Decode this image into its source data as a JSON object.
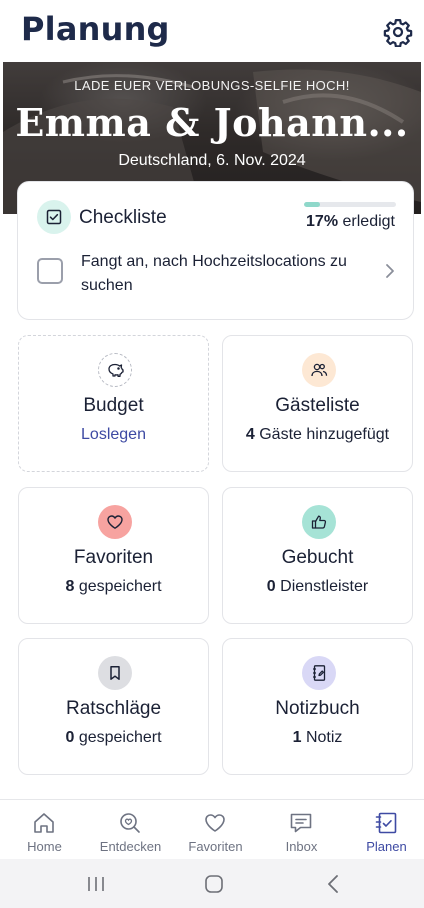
{
  "header": {
    "title": "Planung",
    "settings_icon": "gear-icon"
  },
  "hero": {
    "upload_prompt": "LADE EUER VERLOBUNGS-SELFIE HOCH!",
    "couple_names": "Emma & Johann...",
    "location_date": "Deutschland, 6. Nov. 2024"
  },
  "checklist": {
    "title": "Checkliste",
    "progress_percent": 17,
    "progress_text": "17%",
    "progress_suffix": "erledigt",
    "task": "Fangt an, nach Hochzeitslocations zu suchen"
  },
  "tiles": [
    {
      "title": "Budget",
      "count": "",
      "subtitle": "Loslegen",
      "icon": "piggy-bank-icon",
      "icon_bg": "#ffffff"
    },
    {
      "title": "Gästeliste",
      "count": "4",
      "subtitle": "Gäste hinzugefügt",
      "icon": "guests-icon",
      "icon_bg": "#fde8d4"
    },
    {
      "title": "Favoriten",
      "count": "8",
      "subtitle": "gespeichert",
      "icon": "heart-icon",
      "icon_bg": "#f7a3a0"
    },
    {
      "title": "Gebucht",
      "count": "0",
      "subtitle": "Dienstleister",
      "icon": "thumbs-up-icon",
      "icon_bg": "#a6e3d6"
    },
    {
      "title": "Ratschläge",
      "count": "0",
      "subtitle": "gespeichert",
      "icon": "bookmark-icon",
      "icon_bg": "#dddee2"
    },
    {
      "title": "Notizbuch",
      "count": "1",
      "subtitle": "Notiz",
      "icon": "notebook-icon",
      "icon_bg": "#d9d8f6"
    }
  ],
  "nav": [
    {
      "label": "Home",
      "icon": "home-icon"
    },
    {
      "label": "Entdecken",
      "icon": "discover-icon"
    },
    {
      "label": "Favoriten",
      "icon": "heart-icon"
    },
    {
      "label": "Inbox",
      "icon": "chat-icon"
    },
    {
      "label": "Planen",
      "icon": "planner-icon",
      "active": true
    }
  ],
  "colors": {
    "accent": "#3e4aa3",
    "checklist_progress": "#8fd8ca",
    "title": "#1e2a4a"
  }
}
